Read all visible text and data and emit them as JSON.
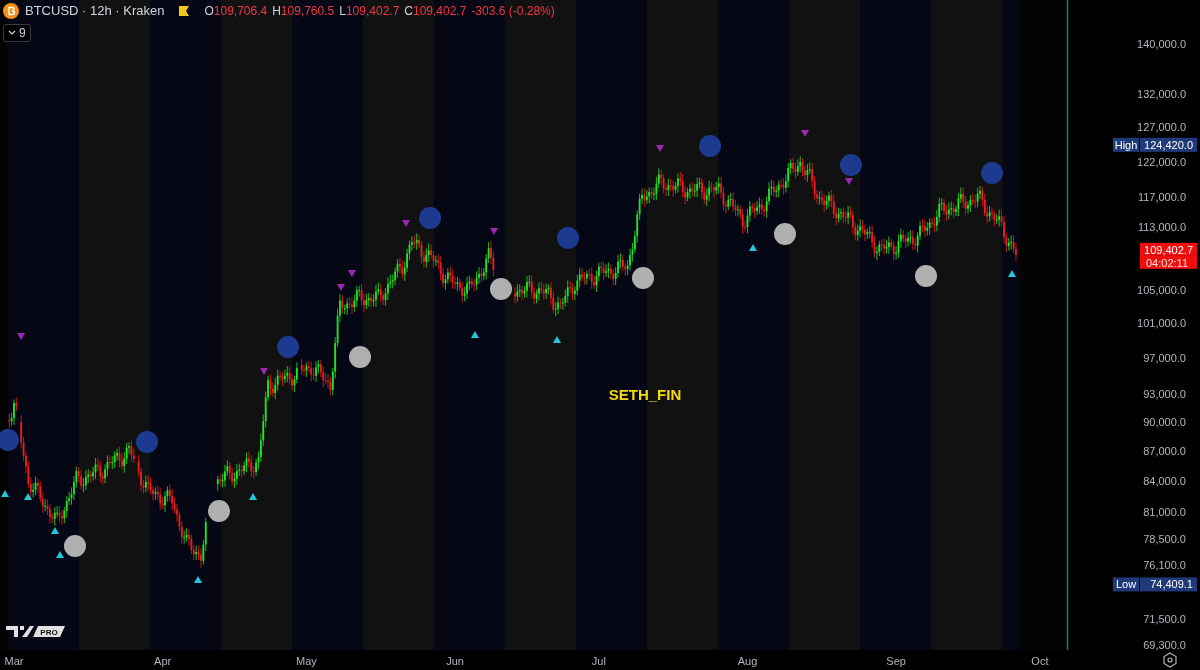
{
  "symbol": {
    "title": "BTCUSD · 12h · Kraken",
    "ohlc": [
      {
        "label": "O",
        "value": "109,706.4"
      },
      {
        "label": "H",
        "value": "109,760.5"
      },
      {
        "label": "L",
        "value": "109,402.7"
      },
      {
        "label": "C",
        "value": "109,402.7"
      }
    ],
    "change": "-303.6 (-0.28%)"
  },
  "indicators_button": {
    "count": "9"
  },
  "chart": {
    "annotation": "SETH_FIN",
    "price_axis": [
      "140,000.0",
      "132,000.0",
      "127,000.0",
      "122,000.0",
      "117,000.0",
      "113,000.0",
      "105,000.0",
      "101,000.0",
      "97,000.0",
      "93,000.0",
      "90,000.0",
      "87,000.0",
      "84,000.0",
      "81,000.0",
      "78,500.0",
      "76,100.0",
      "71,500.0",
      "69,300.0"
    ],
    "time_axis": [
      "Mar",
      "Apr",
      "May",
      "Jun",
      "Jul",
      "Aug",
      "Sep",
      "Oct"
    ],
    "price_labels": [
      {
        "kind": "high",
        "label": "High",
        "value": "124,420.0"
      },
      {
        "kind": "last",
        "value": "109,402.7",
        "countdown": "04:02:11"
      },
      {
        "kind": "low",
        "label": "Low",
        "value": "74,409.1"
      }
    ]
  },
  "logo": {
    "badge": "PRO"
  }
}
